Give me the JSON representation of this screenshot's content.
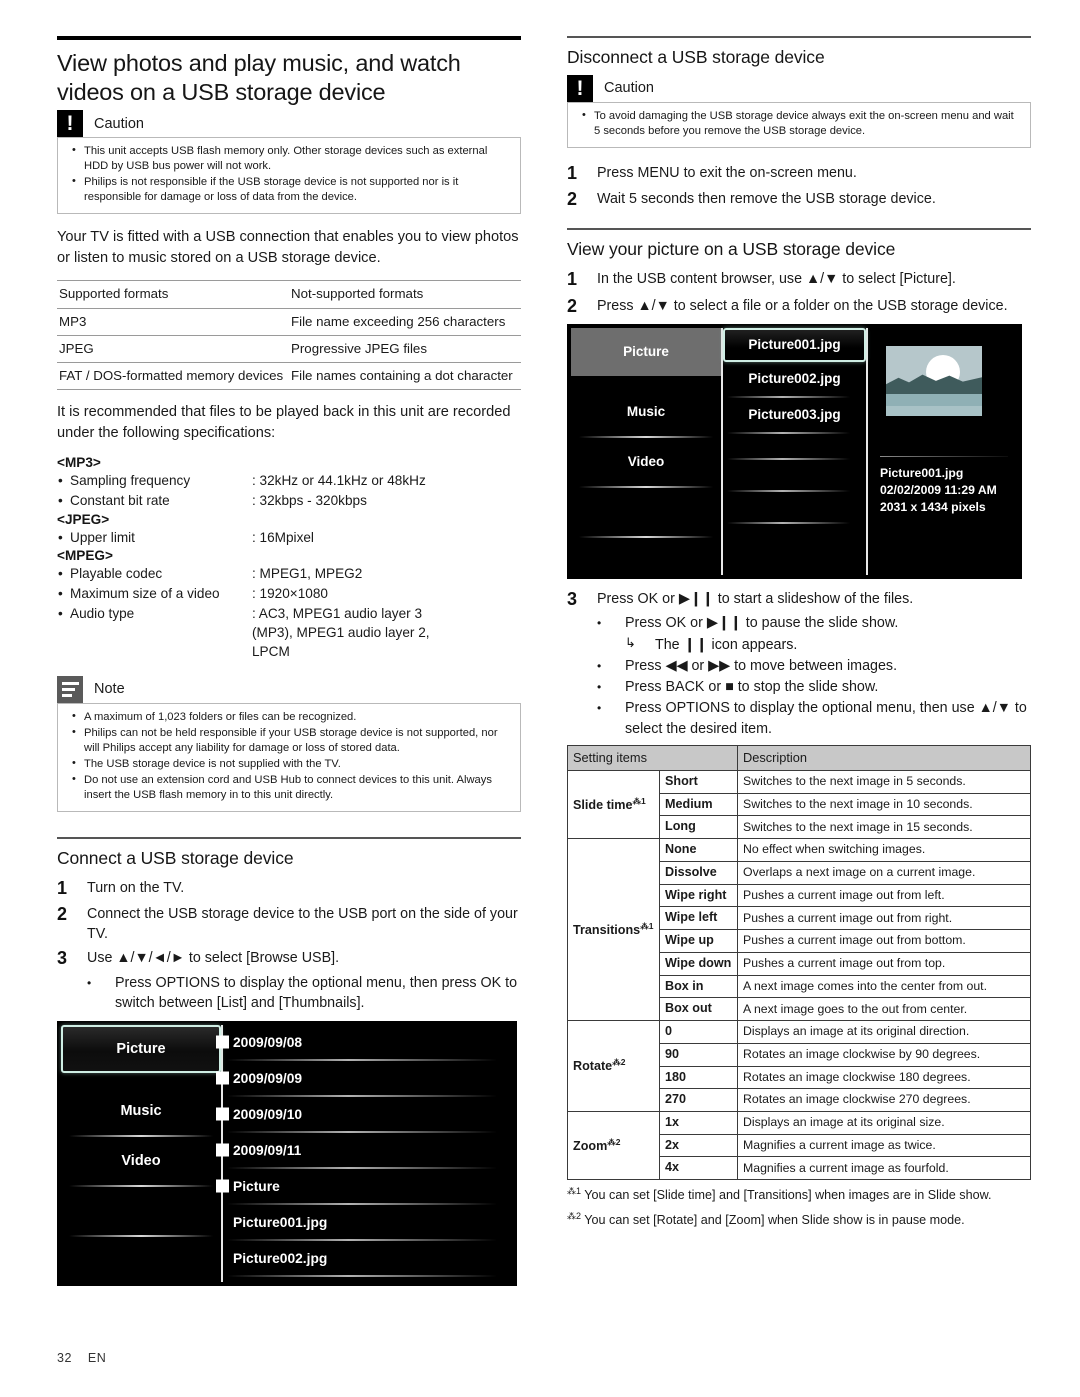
{
  "page": {
    "number": "32",
    "lang": "EN"
  },
  "left": {
    "section_title": "View photos and play music, and watch videos on a USB storage device",
    "caution": {
      "label": "Caution",
      "items": [
        "This unit accepts USB flash memory only. Other storage devices such as external HDD by USB bus power will not work.",
        "Philips is not responsible if the USB storage device is not supported nor is it responsible for damage or loss of data from the device."
      ]
    },
    "intro": "Your TV is fitted with a USB connection that enables you to view photos or listen to music stored on a USB storage device.",
    "format_table": {
      "headers": [
        "Supported formats",
        "Not-supported formats"
      ],
      "rows": [
        [
          "MP3",
          "File name exceeding 256 characters"
        ],
        [
          "JPEG",
          "Progressive JPEG files"
        ],
        [
          "FAT / DOS-formatted memory devices",
          "File names containing a dot character"
        ]
      ]
    },
    "recommend": "It is recommended that files to be played back in this unit are recorded under the following specifications:",
    "specs": [
      {
        "heading": "<MP3>",
        "rows": [
          {
            "key": "Sampling frequency",
            "value": ": 32kHz or 44.1kHz or 48kHz"
          },
          {
            "key": "Constant bit rate",
            "value": ": 32kbps - 320kbps"
          }
        ]
      },
      {
        "heading": "<JPEG>",
        "rows": [
          {
            "key": "Upper limit",
            "value": ": 16Mpixel"
          }
        ]
      },
      {
        "heading": "<MPEG>",
        "rows": [
          {
            "key": "Playable codec",
            "value": ": MPEG1, MPEG2"
          },
          {
            "key": "Maximum size of a video",
            "value": ": 1920×1080"
          },
          {
            "key": "Audio type",
            "value": ": AC3, MPEG1 audio layer 3\n  (MP3), MPEG1 audio layer 2,\n  LPCM"
          }
        ]
      }
    ],
    "note": {
      "label": "Note",
      "items": [
        "A maximum of 1,023 folders or files can be recognized.",
        "Philips can not be held responsible if your USB storage device is not supported, nor will Philips accept any liability for damage or loss of stored data.",
        "The USB storage device is not supplied with the TV.",
        "Do not use an extension cord and USB Hub to connect devices to this unit. Always insert the USB flash memory in to this unit directly."
      ]
    },
    "connect": {
      "title": "Connect a USB storage device",
      "steps": [
        {
          "n": "1",
          "text": "Turn on the TV."
        },
        {
          "n": "2",
          "text": "Connect the USB storage device to the USB port on the side of your TV."
        },
        {
          "n": "3",
          "text": "Use ▲/▼/◄/► to select [Browse USB]."
        }
      ],
      "sub_bullet": "Press OPTIONS to display the optional menu, then press OK to switch between [List] and [Thumbnails]."
    },
    "tv_screen": {
      "nav": [
        {
          "label": "Picture",
          "selected": true
        },
        {
          "label": "Music",
          "selected": false
        },
        {
          "label": "Video",
          "selected": false
        }
      ],
      "list": [
        {
          "label": "2009/09/08",
          "folder": true
        },
        {
          "label": "2009/09/09",
          "folder": true
        },
        {
          "label": "2009/09/10",
          "folder": true
        },
        {
          "label": "2009/09/11",
          "folder": true
        },
        {
          "label": "Picture",
          "folder": true
        },
        {
          "label": "Picture001.jpg",
          "folder": false
        },
        {
          "label": "Picture002.jpg",
          "folder": false
        }
      ]
    }
  },
  "right": {
    "disconnect": {
      "title": "Disconnect a USB storage device",
      "caution": {
        "label": "Caution",
        "items": [
          "To avoid damaging the USB storage device always exit the on-screen menu and wait 5 seconds before you remove the USB storage device."
        ]
      },
      "steps": [
        {
          "n": "1",
          "text": "Press MENU to exit the on-screen menu."
        },
        {
          "n": "2",
          "text": "Wait 5 seconds then remove the USB storage device."
        }
      ]
    },
    "view_picture": {
      "title": "View your picture on a USB storage device",
      "steps": [
        {
          "n": "1",
          "text": "In the USB content browser, use ▲/▼ to select [Picture]."
        },
        {
          "n": "2",
          "text": "Press ▲/▼ to select a file or a folder on the USB storage device."
        },
        {
          "n": "3",
          "text": "Press OK or ▶❙❙ to start a slideshow of the files."
        }
      ],
      "bullets": [
        "Press OK or ▶❙❙ to pause the slide show.",
        "Press ◀◀ or ▶▶ to move between images.",
        "Press BACK or ■ to stop the slide show.",
        "Press OPTIONS to display the optional menu, then use ▲/▼ to select the desired item."
      ],
      "arrow_note": "The ❙❙ icon appears."
    },
    "tv_screen": {
      "nav": [
        {
          "label": "Picture",
          "selected": true
        },
        {
          "label": "Music",
          "selected": false
        },
        {
          "label": "Video",
          "selected": false
        }
      ],
      "list": [
        {
          "label": "Picture001.jpg",
          "selected": true
        },
        {
          "label": "Picture002.jpg",
          "selected": false
        },
        {
          "label": "Picture003.jpg",
          "selected": false
        }
      ],
      "preview": {
        "filename": "Picture001.jpg",
        "timestamp": "02/02/2009 11:29 AM",
        "dimensions": "2031 x 1434 pixels"
      }
    },
    "settings_table": {
      "headers": [
        "Setting items",
        "Description"
      ],
      "groups": [
        {
          "name": "Slide time",
          "footnote": "1",
          "rows": [
            {
              "value": "Short",
              "desc": "Switches to the next image in 5 seconds."
            },
            {
              "value": "Medium",
              "desc": "Switches to the next image in 10 seconds."
            },
            {
              "value": "Long",
              "desc": "Switches to the next image in 15 seconds."
            }
          ]
        },
        {
          "name": "Transitions",
          "footnote": "1",
          "rows": [
            {
              "value": "None",
              "desc": "No effect when switching images."
            },
            {
              "value": "Dissolve",
              "desc": "Overlaps a next image on a current image."
            },
            {
              "value": "Wipe right",
              "desc": "Pushes a current image out from left."
            },
            {
              "value": "Wipe left",
              "desc": "Pushes a current image out from right."
            },
            {
              "value": "Wipe up",
              "desc": "Pushes a current image out from bottom."
            },
            {
              "value": "Wipe down",
              "desc": "Pushes a current image out from top."
            },
            {
              "value": "Box in",
              "desc": "A next image comes into the center from out."
            },
            {
              "value": "Box out",
              "desc": "A next image goes to the out from center."
            }
          ]
        },
        {
          "name": "Rotate",
          "footnote": "2",
          "rows": [
            {
              "value": "0",
              "desc": "Displays an image at its original direction."
            },
            {
              "value": "90",
              "desc": "Rotates an image clockwise by 90 degrees."
            },
            {
              "value": "180",
              "desc": "Rotates an image clockwise 180 degrees."
            },
            {
              "value": "270",
              "desc": "Rotates an image clockwise 270 degrees."
            }
          ]
        },
        {
          "name": "Zoom",
          "footnote": "2",
          "rows": [
            {
              "value": "1x",
              "desc": "Displays an image at its original size."
            },
            {
              "value": "2x",
              "desc": "Magnifies a current image as twice."
            },
            {
              "value": "4x",
              "desc": "Magnifies a current image as fourfold."
            }
          ]
        }
      ],
      "footnotes": [
        {
          "marker": "1",
          "text": "You can set [Slide time] and [Transitions] when images are in Slide show."
        },
        {
          "marker": "2",
          "text": "You can set [Rotate] and [Zoom] when Slide show is in pause mode."
        }
      ]
    }
  }
}
